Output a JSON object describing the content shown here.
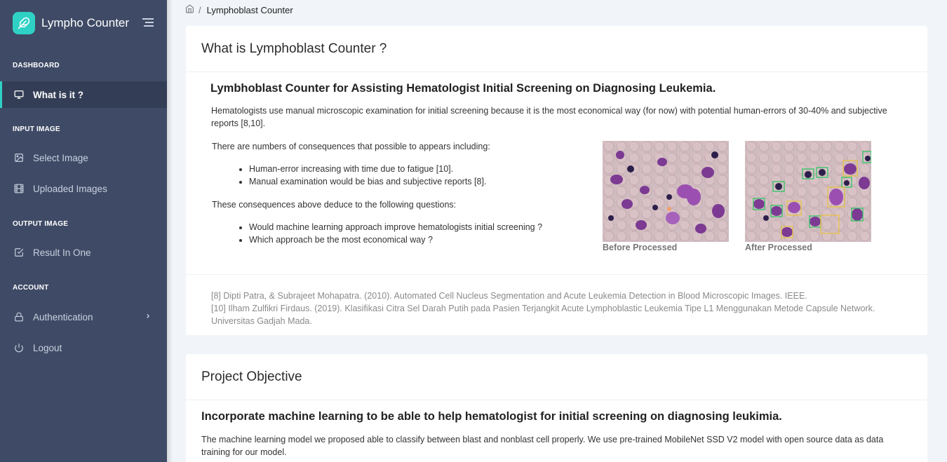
{
  "app": {
    "name": "Lympho Counter"
  },
  "sidebar": {
    "sections": [
      {
        "title": "DASHBOARD",
        "items": [
          {
            "label": "What is it ?",
            "icon": "monitor-icon",
            "active": true
          }
        ]
      },
      {
        "title": "INPUT IMAGE",
        "items": [
          {
            "label": "Select Image",
            "icon": "image-icon"
          },
          {
            "label": "Uploaded Images",
            "icon": "film-icon"
          }
        ]
      },
      {
        "title": "OUTPUT IMAGE",
        "items": [
          {
            "label": "Result In One",
            "icon": "check-square-icon"
          }
        ]
      },
      {
        "title": "ACCOUNT",
        "items": [
          {
            "label": "Authentication",
            "icon": "lock-icon"
          },
          {
            "label": "Logout",
            "icon": "power-icon"
          }
        ]
      }
    ],
    "accent_color": "#2fd1c5",
    "background_color": "#3f4b66"
  },
  "breadcrumb": {
    "home_icon": "home-icon",
    "separator": "/",
    "current": "Lymphoblast Counter"
  },
  "card1": {
    "title": "What is Lymphoblast Counter ?",
    "headline": "Lymbhoblast Counter for Assisting Hematologist Initial Screening on Diagnosing Leukemia.",
    "intro": "Hematologists use manual microscopic examination for initial screening because it is the most economical way (for now) with potential human-errors of 30-40% and subjective reports [8,10].",
    "consequences_intro": "There are numbers of consequences that possible to appears including:",
    "consequences": [
      "Human-error increasing with time due to fatigue [10].",
      "Manual examination would be bias and subjective reports [8]."
    ],
    "questions_intro": "These consequences above deduce to the following questions:",
    "questions": [
      "Would machine learning approach improve hematologists initial screening ?",
      "Which approach be the most economical way ?"
    ],
    "images": [
      {
        "caption": "Before Processed"
      },
      {
        "caption": "After Processed"
      }
    ],
    "references": [
      "[8] Dipti Patra, & Subrajeet Mohapatra. (2010). Automated Cell Nucleus Segmentation and Acute Leukemia Detection in Blood Microscopic Images. IEEE.",
      "[10] Ilham Zulfikri Firdaus. (2019). Klasifikasi Citra Sel Darah Putih pada Pasien Terjangkit Acute Lymphoblastic Leukemia Tipe L1 Menggunakan Metode Capsule Network. Universitas Gadjah Mada."
    ]
  },
  "card2": {
    "title": "Project Objective",
    "headline": "Incorporate machine learning to be able to help hematologist for initial screening on diagnosing leukimia.",
    "body": "The machine learning model we proposed able to classify between blast and nonblast cell properly. We use pre-trained MobileNet SSD V2 model with open source data as data training for our model."
  }
}
